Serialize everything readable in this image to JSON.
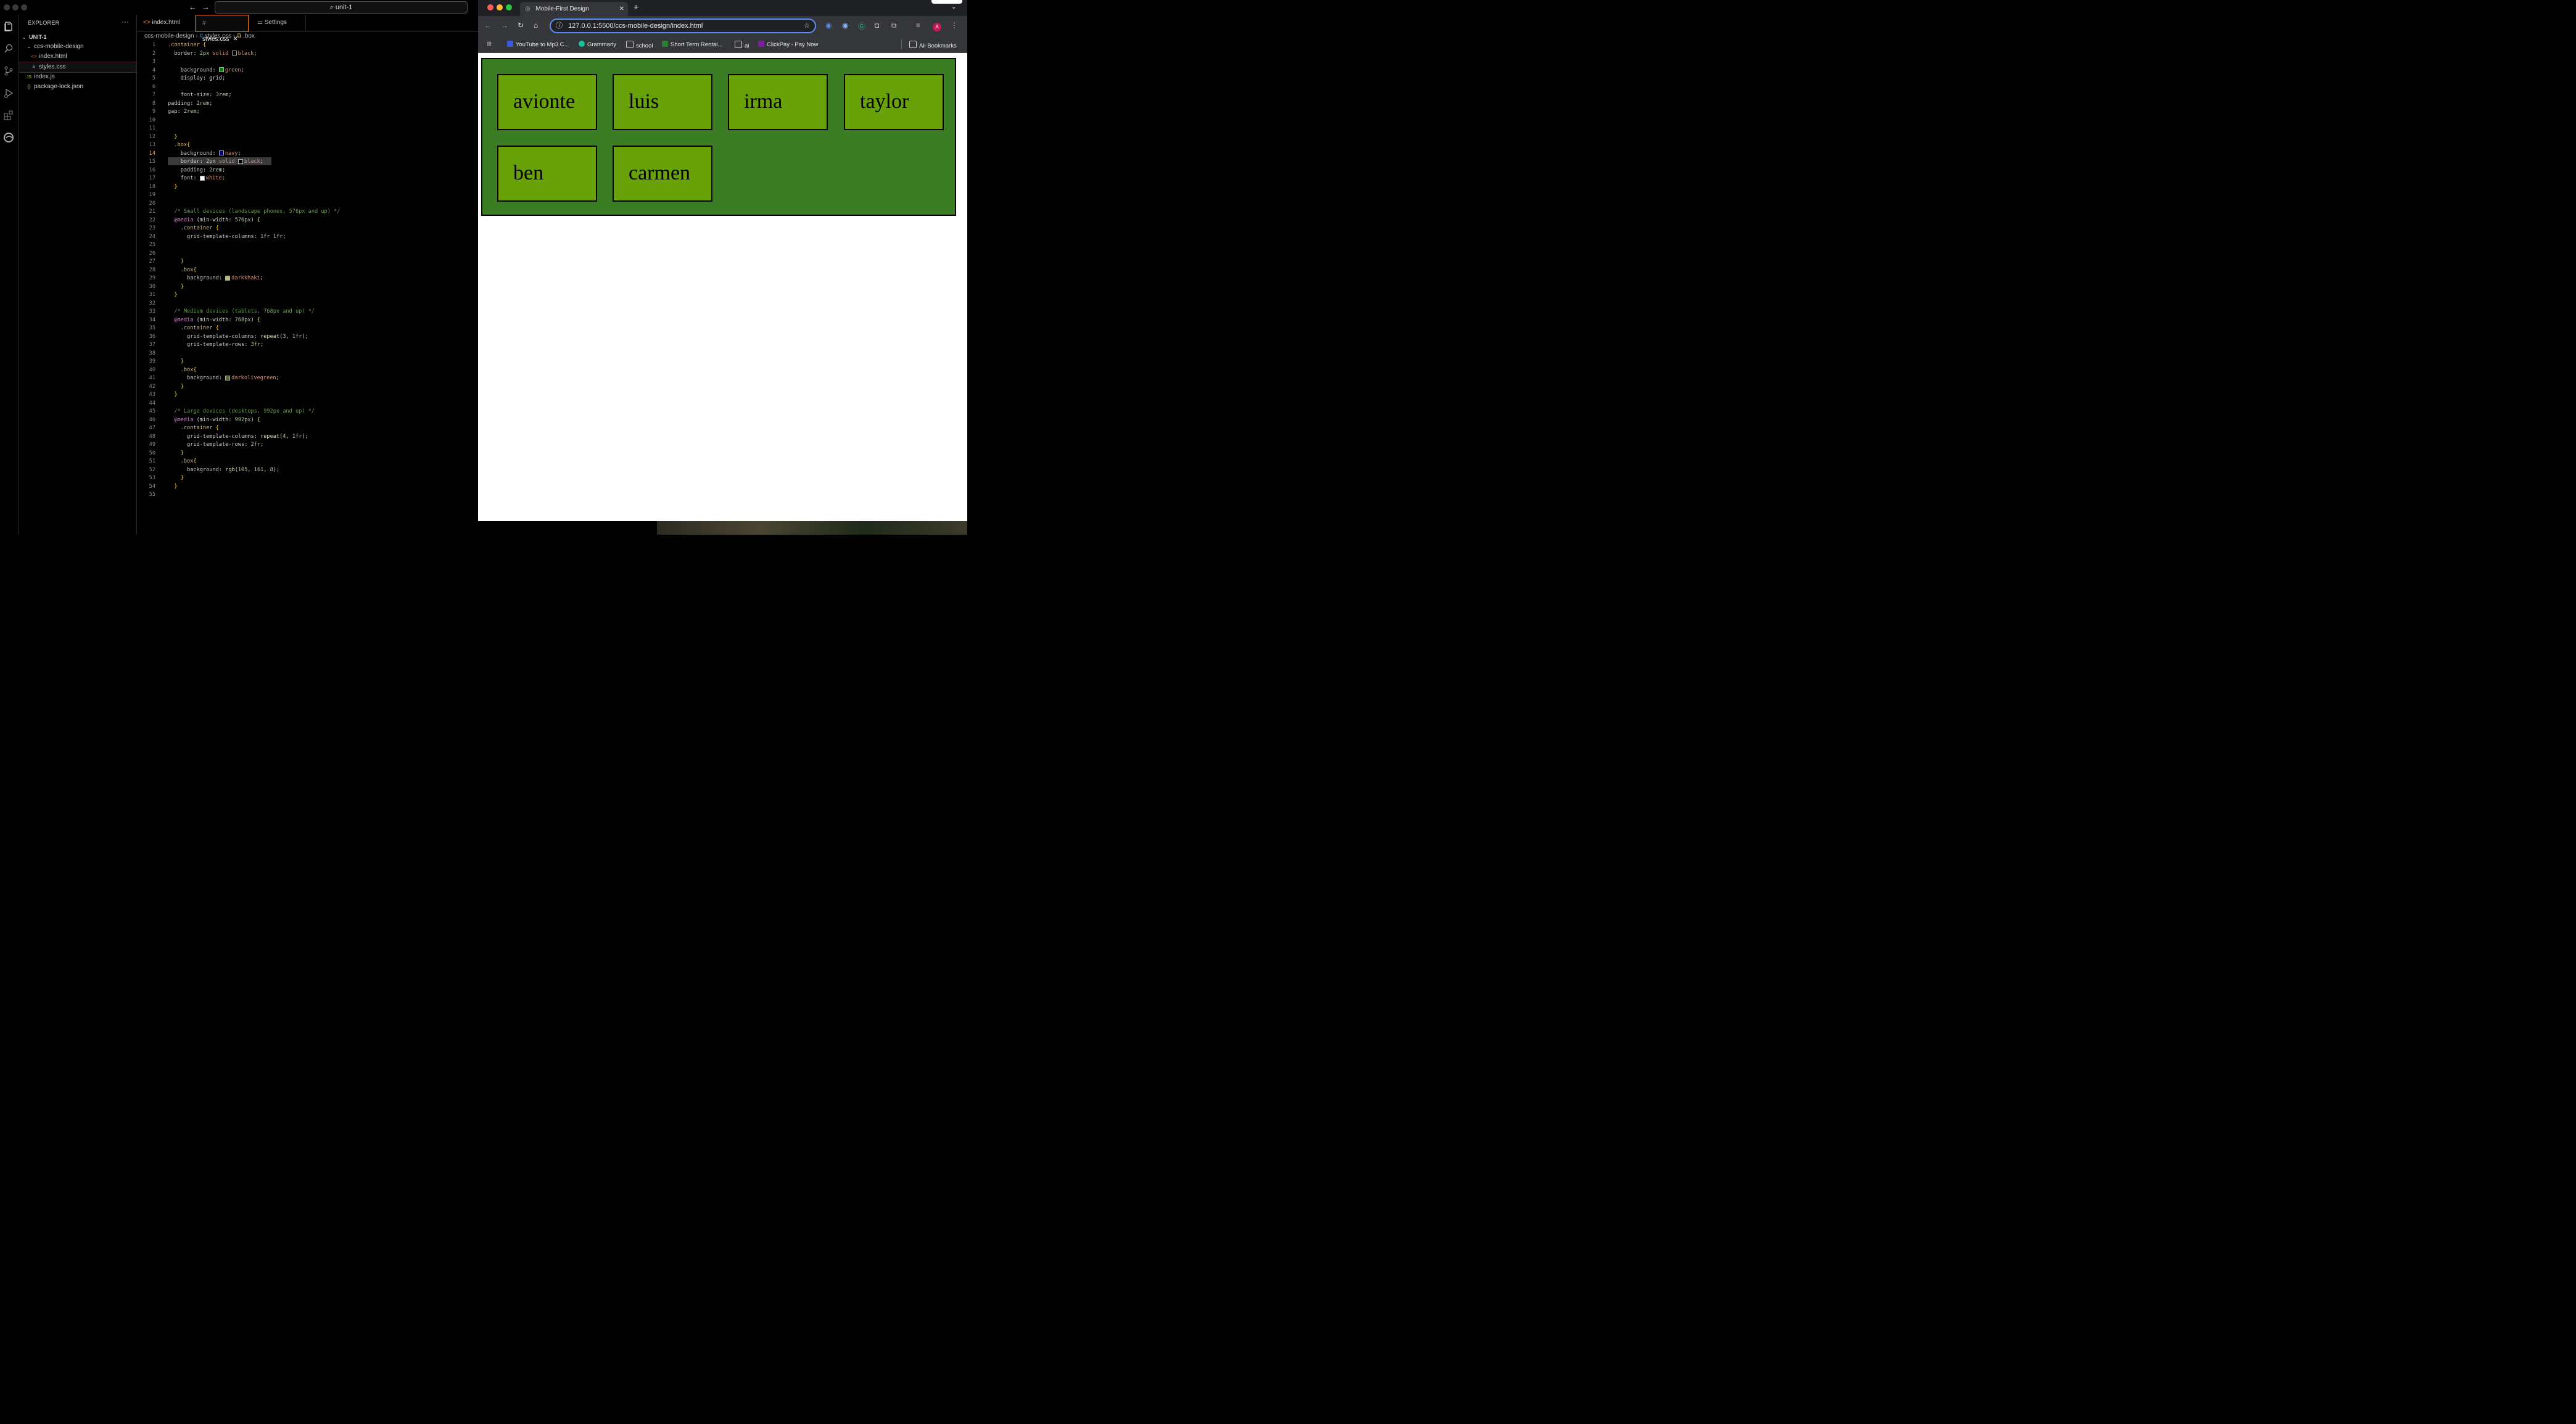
{
  "vscode": {
    "command_center": "unit-1",
    "explorer": {
      "title": "EXPLORER",
      "root": "UNIT-1",
      "folder": "ccs-mobile-design",
      "files_in_folder": [
        "index.html",
        "styles.css"
      ],
      "root_files": [
        "index.js",
        "package-lock.json"
      ]
    },
    "tabs": [
      "index.html",
      "styles.css",
      "Settings"
    ],
    "breadcrumb": [
      "ccs-mobile-design",
      "styles.css",
      ".box"
    ],
    "lines": [
      ".container {",
      "  border: 2px solid black;",
      "",
      "    background: green;",
      "    display: grid;",
      "",
      "    font-size: 3rem;",
      "padding: 2rem;",
      "gap: 2rem;",
      "",
      "",
      "  }",
      "  .box{",
      "    background: navy;",
      "    border: 2px solid black;",
      "    padding: 2rem;",
      "    font: white;",
      "  }",
      "",
      "",
      "  /* Small devices (landscape phones, 576px and up) */",
      "  @media (min-width: 576px) {",
      "    .container {",
      "      grid-template-columns: 1fr 1fr;",
      "",
      "",
      "    }",
      "    .box{",
      "      background: darkkhaki;",
      "    }",
      "  }",
      "",
      "  /* Medium devices (tablets, 768px and up) */",
      "  @media (min-width: 768px) {",
      "    .container {",
      "      grid-template-columns: repeat(3, 1fr);",
      "      grid-template-rows: 3fr;",
      "",
      "    }",
      "    .box{",
      "      background: darkolivegreen;",
      "    }",
      "  }",
      "",
      "  /* Large devices (desktops, 992px and up) */",
      "  @media (min-width: 992px) {",
      "    .container {",
      "      grid-template-columns: repeat(4, 1fr);",
      "      grid-template-rows: 2fr;",
      "    }",
      "    .box{",
      "      background: rgb(105, 161, 8);",
      "    }",
      "  }",
      ""
    ],
    "current_line": 14
  },
  "chrome": {
    "tab_title": "Mobile-First Design",
    "url": "127.0.0.1:5500/ccs-mobile-design/index.html",
    "bookmarks": [
      "YouTube to Mp3 C...",
      "Grammarly",
      "school",
      "Short Term Rental...",
      "ai",
      "ClickPay - Pay Now"
    ],
    "all_bookmarks": "All Bookmarks",
    "profile_initial": "A",
    "boxes": [
      "avionte",
      "luis",
      "irma",
      "taylor",
      "ben",
      "carmen"
    ],
    "colors": {
      "container": "#3a7d22",
      "box": "#69a108",
      "url_focus": "#5b8ef0"
    }
  }
}
